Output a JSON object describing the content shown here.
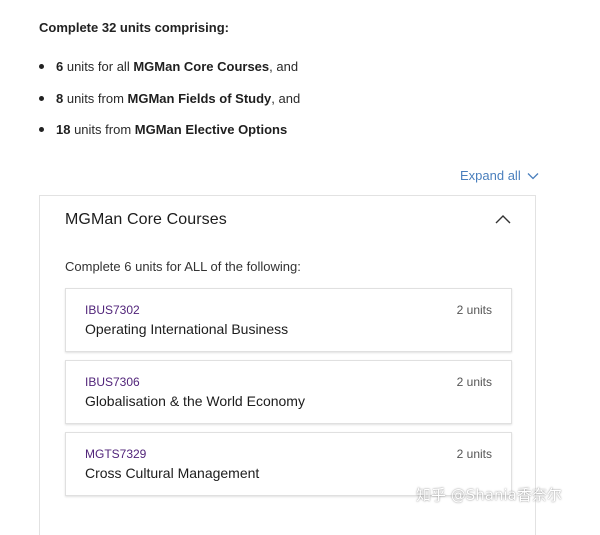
{
  "intro": {
    "heading": "Complete 32 units comprising:"
  },
  "requirements": [
    {
      "count": "6",
      "mid": " units for all ",
      "group": "MGMan Core Courses",
      "tail": ", and"
    },
    {
      "count": "8",
      "mid": " units from ",
      "group": "MGMan Fields of Study",
      "tail": ", and"
    },
    {
      "count": "18",
      "mid": " units from ",
      "group": "MGMan Elective Options",
      "tail": ""
    }
  ],
  "expand": {
    "label": "Expand all",
    "icon": "chevron-down-icon",
    "color": "#4a7fbd"
  },
  "panel": {
    "title": "MGMan Core Courses",
    "collapse_icon": "chevron-up-icon",
    "subtitle": "Complete 6 units for ALL of the following:"
  },
  "courses": [
    {
      "code": "IBUS7302",
      "name": "Operating International Business",
      "units": "2 units"
    },
    {
      "code": "IBUS7306",
      "name": "Globalisation & the World Economy",
      "units": "2 units"
    },
    {
      "code": "MGTS7329",
      "name": "Cross Cultural Management",
      "units": "2 units"
    }
  ],
  "colors": {
    "course_code": "#51247a",
    "link": "#4a7fbd"
  },
  "watermark": {
    "text": "知乎 @Shania香奈尔"
  }
}
